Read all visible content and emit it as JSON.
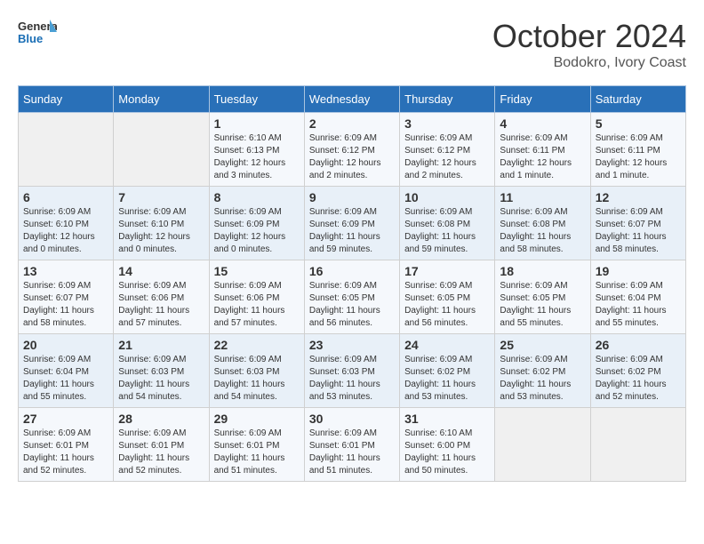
{
  "header": {
    "logo_line1": "General",
    "logo_line2": "Blue",
    "month_title": "October 2024",
    "subtitle": "Bodokro, Ivory Coast"
  },
  "weekdays": [
    "Sunday",
    "Monday",
    "Tuesday",
    "Wednesday",
    "Thursday",
    "Friday",
    "Saturday"
  ],
  "weeks": [
    [
      {
        "day": "",
        "info": ""
      },
      {
        "day": "",
        "info": ""
      },
      {
        "day": "1",
        "info": "Sunrise: 6:10 AM\nSunset: 6:13 PM\nDaylight: 12 hours\nand 3 minutes."
      },
      {
        "day": "2",
        "info": "Sunrise: 6:09 AM\nSunset: 6:12 PM\nDaylight: 12 hours\nand 2 minutes."
      },
      {
        "day": "3",
        "info": "Sunrise: 6:09 AM\nSunset: 6:12 PM\nDaylight: 12 hours\nand 2 minutes."
      },
      {
        "day": "4",
        "info": "Sunrise: 6:09 AM\nSunset: 6:11 PM\nDaylight: 12 hours\nand 1 minute."
      },
      {
        "day": "5",
        "info": "Sunrise: 6:09 AM\nSunset: 6:11 PM\nDaylight: 12 hours\nand 1 minute."
      }
    ],
    [
      {
        "day": "6",
        "info": "Sunrise: 6:09 AM\nSunset: 6:10 PM\nDaylight: 12 hours\nand 0 minutes."
      },
      {
        "day": "7",
        "info": "Sunrise: 6:09 AM\nSunset: 6:10 PM\nDaylight: 12 hours\nand 0 minutes."
      },
      {
        "day": "8",
        "info": "Sunrise: 6:09 AM\nSunset: 6:09 PM\nDaylight: 12 hours\nand 0 minutes."
      },
      {
        "day": "9",
        "info": "Sunrise: 6:09 AM\nSunset: 6:09 PM\nDaylight: 11 hours\nand 59 minutes."
      },
      {
        "day": "10",
        "info": "Sunrise: 6:09 AM\nSunset: 6:08 PM\nDaylight: 11 hours\nand 59 minutes."
      },
      {
        "day": "11",
        "info": "Sunrise: 6:09 AM\nSunset: 6:08 PM\nDaylight: 11 hours\nand 58 minutes."
      },
      {
        "day": "12",
        "info": "Sunrise: 6:09 AM\nSunset: 6:07 PM\nDaylight: 11 hours\nand 58 minutes."
      }
    ],
    [
      {
        "day": "13",
        "info": "Sunrise: 6:09 AM\nSunset: 6:07 PM\nDaylight: 11 hours\nand 58 minutes."
      },
      {
        "day": "14",
        "info": "Sunrise: 6:09 AM\nSunset: 6:06 PM\nDaylight: 11 hours\nand 57 minutes."
      },
      {
        "day": "15",
        "info": "Sunrise: 6:09 AM\nSunset: 6:06 PM\nDaylight: 11 hours\nand 57 minutes."
      },
      {
        "day": "16",
        "info": "Sunrise: 6:09 AM\nSunset: 6:05 PM\nDaylight: 11 hours\nand 56 minutes."
      },
      {
        "day": "17",
        "info": "Sunrise: 6:09 AM\nSunset: 6:05 PM\nDaylight: 11 hours\nand 56 minutes."
      },
      {
        "day": "18",
        "info": "Sunrise: 6:09 AM\nSunset: 6:05 PM\nDaylight: 11 hours\nand 55 minutes."
      },
      {
        "day": "19",
        "info": "Sunrise: 6:09 AM\nSunset: 6:04 PM\nDaylight: 11 hours\nand 55 minutes."
      }
    ],
    [
      {
        "day": "20",
        "info": "Sunrise: 6:09 AM\nSunset: 6:04 PM\nDaylight: 11 hours\nand 55 minutes."
      },
      {
        "day": "21",
        "info": "Sunrise: 6:09 AM\nSunset: 6:03 PM\nDaylight: 11 hours\nand 54 minutes."
      },
      {
        "day": "22",
        "info": "Sunrise: 6:09 AM\nSunset: 6:03 PM\nDaylight: 11 hours\nand 54 minutes."
      },
      {
        "day": "23",
        "info": "Sunrise: 6:09 AM\nSunset: 6:03 PM\nDaylight: 11 hours\nand 53 minutes."
      },
      {
        "day": "24",
        "info": "Sunrise: 6:09 AM\nSunset: 6:02 PM\nDaylight: 11 hours\nand 53 minutes."
      },
      {
        "day": "25",
        "info": "Sunrise: 6:09 AM\nSunset: 6:02 PM\nDaylight: 11 hours\nand 53 minutes."
      },
      {
        "day": "26",
        "info": "Sunrise: 6:09 AM\nSunset: 6:02 PM\nDaylight: 11 hours\nand 52 minutes."
      }
    ],
    [
      {
        "day": "27",
        "info": "Sunrise: 6:09 AM\nSunset: 6:01 PM\nDaylight: 11 hours\nand 52 minutes."
      },
      {
        "day": "28",
        "info": "Sunrise: 6:09 AM\nSunset: 6:01 PM\nDaylight: 11 hours\nand 52 minutes."
      },
      {
        "day": "29",
        "info": "Sunrise: 6:09 AM\nSunset: 6:01 PM\nDaylight: 11 hours\nand 51 minutes."
      },
      {
        "day": "30",
        "info": "Sunrise: 6:09 AM\nSunset: 6:01 PM\nDaylight: 11 hours\nand 51 minutes."
      },
      {
        "day": "31",
        "info": "Sunrise: 6:10 AM\nSunset: 6:00 PM\nDaylight: 11 hours\nand 50 minutes."
      },
      {
        "day": "",
        "info": ""
      },
      {
        "day": "",
        "info": ""
      }
    ]
  ]
}
